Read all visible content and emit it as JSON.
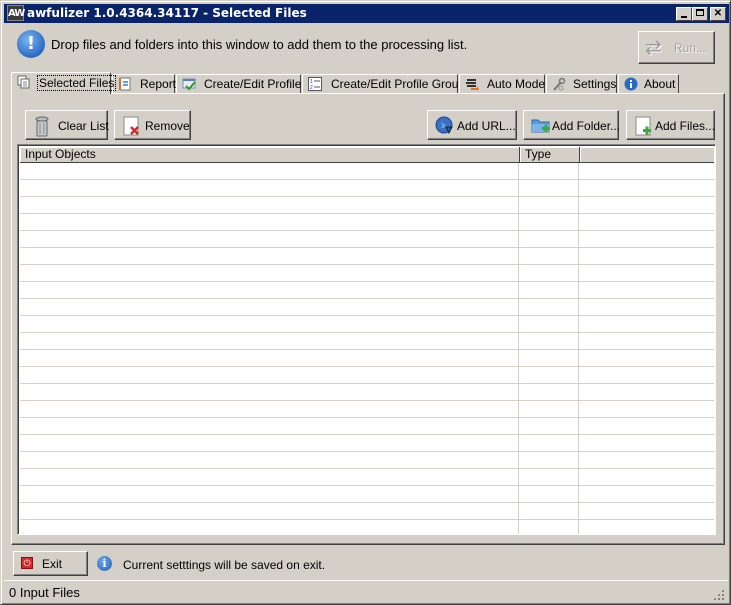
{
  "window": {
    "icon_label": "AW",
    "title": "awfulizer 1.0.4364.34117 - Selected Files"
  },
  "header": {
    "drop_message": "Drop files and folders into this window to add them to the processing list.",
    "run_label": "Run..."
  },
  "tabs": [
    {
      "label": "Selected Files",
      "icon": "documents-icon",
      "active": true
    },
    {
      "label": "Report",
      "icon": "report-notebook-icon",
      "active": false
    },
    {
      "label": "Create/Edit Profiles",
      "icon": "profile-check-icon",
      "active": false
    },
    {
      "label": "Create/Edit Profile Groups",
      "icon": "numbered-list-icon",
      "active": false
    },
    {
      "label": "Auto Mode",
      "icon": "auto-mode-stack-icon",
      "active": false
    },
    {
      "label": "Settings",
      "icon": "wrench-settings-icon",
      "active": false
    },
    {
      "label": "About",
      "icon": "info-icon",
      "active": false
    }
  ],
  "toolbar": {
    "clear_list": "Clear List",
    "remove": "Remove",
    "add_url": "Add URL...",
    "add_folder": "Add Folder...",
    "add_files": "Add Files..."
  },
  "list": {
    "columns": [
      "Input Objects",
      "Type",
      ""
    ],
    "rows": []
  },
  "footer": {
    "exit_label": "Exit",
    "save_message": "Current setttings will be saved on exit."
  },
  "status": {
    "text": "0 Input Files"
  }
}
